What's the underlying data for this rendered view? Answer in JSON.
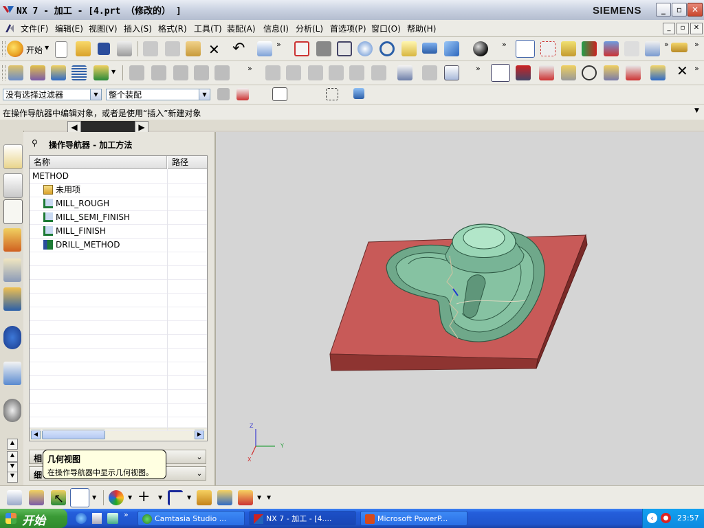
{
  "window": {
    "title": "NX 7 - 加工 - [4.prt （修改的） ]",
    "brand": "SIEMENS",
    "min_btn": "_",
    "restore_btn": "▫",
    "close_btn": "✕"
  },
  "menu": {
    "items": [
      "文件(F)",
      "编辑(E)",
      "视图(V)",
      "插入(S)",
      "格式(R)",
      "工具(T)",
      "装配(A)",
      "信息(I)",
      "分析(L)",
      "首选项(P)",
      "窗口(O)",
      "帮助(H)"
    ]
  },
  "toolbar": {
    "start_label": "开始"
  },
  "filter": {
    "selection_filter": "没有选择过滤器",
    "assembly_scope": "整个装配"
  },
  "cue_line": "在操作导航器中编辑对象，或者是使用“插入”新建对象",
  "navigator": {
    "title": "操作导航器 - 加工方法",
    "columns": [
      "名称",
      "路径"
    ],
    "rows": [
      "METHOD",
      "未用项",
      "MILL_ROUGH",
      "MILL_SEMI_FINISH",
      "MILL_FINISH",
      "DRILL_METHOD"
    ],
    "section_1": "相",
    "section_2": "细"
  },
  "tooltip": {
    "title": "几何视图",
    "body": "在操作导航器中显示几何视图。"
  },
  "axes": {
    "x": "X",
    "y": "Y",
    "z": "Z"
  },
  "taskbar": {
    "start": "开始",
    "tasks": [
      "Camtasia Studio ...",
      "NX 7 - 加工 - [4....",
      "Microsoft PowerP..."
    ],
    "clock": "23:57"
  }
}
